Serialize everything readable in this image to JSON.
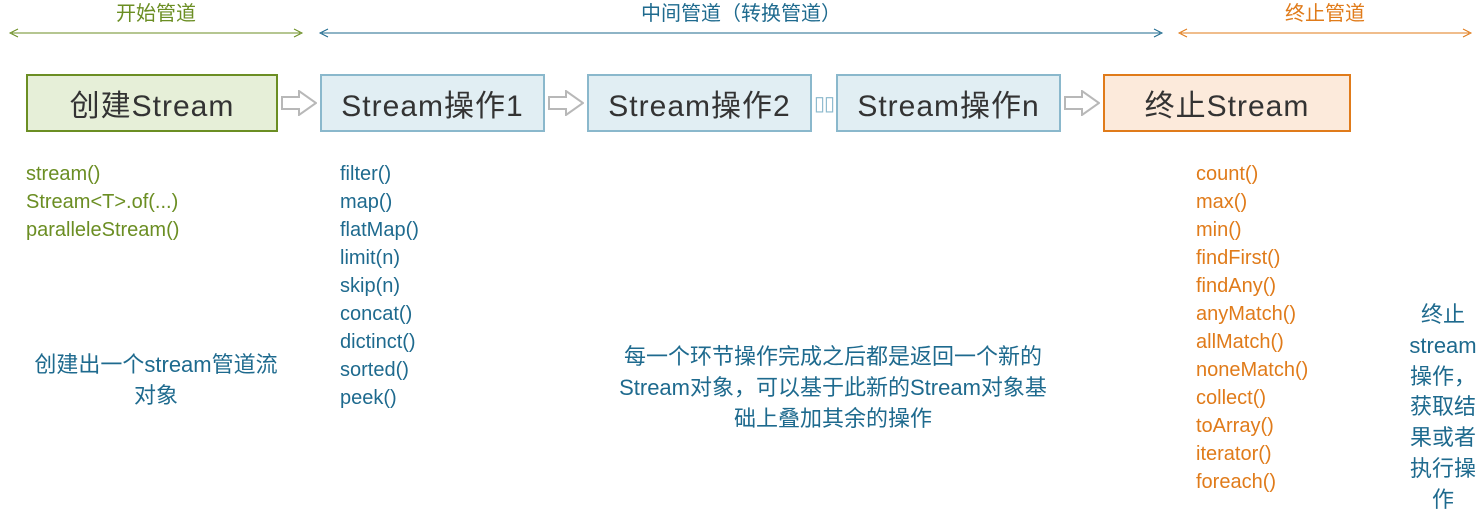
{
  "header": {
    "start": "开始管道",
    "middle": "中间管道（转换管道）",
    "end": "终止管道"
  },
  "boxes": {
    "create": "创建Stream",
    "op1": "Stream操作1",
    "op2": "Stream操作2",
    "opn": "Stream操作n",
    "terminate": "终止Stream"
  },
  "create_methods": {
    "m0": "stream()",
    "m1": "Stream<T>.of(...)",
    "m2": "paralleleStream()"
  },
  "op_methods": {
    "m0": "filter()",
    "m1": "map()",
    "m2": "flatMap()",
    "m3": "limit(n)",
    "m4": "skip(n)",
    "m5": "concat()",
    "m6": "dictinct()",
    "m7": "sorted()",
    "m8": "peek()"
  },
  "term_methods": {
    "m0": "count()",
    "m1": "max()",
    "m2": "min()",
    "m3": "findFirst()",
    "m4": "findAny()",
    "m5": "anyMatch()",
    "m6": "allMatch()",
    "m7": "noneMatch()",
    "m8": "collect()",
    "m9": "toArray()",
    "m10": "iterator()",
    "m11": "foreach()"
  },
  "desc": {
    "create": "创建出一个stream管道流对象",
    "mid": "每一个环节操作完成之后都是返回一个新的Stream对象，可以基于此新的Stream对象基础上叠加其余的操作",
    "term": "终止stream操作，获取结果或者执行操作"
  },
  "glyphs": {
    "dots": "▯▯"
  }
}
